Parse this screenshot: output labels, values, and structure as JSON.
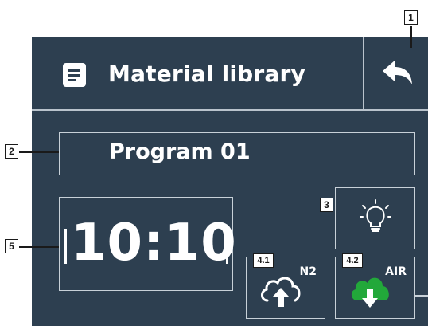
{
  "header": {
    "title": "Material library",
    "title_icon": "document-icon",
    "back_icon": "back-arrow-icon"
  },
  "program": {
    "label": "Program 01"
  },
  "clock": {
    "time": "10:10"
  },
  "light": {
    "icon": "lightbulb-icon"
  },
  "gas_buttons": [
    {
      "label": "N2",
      "icon": "cloud-upload-icon",
      "color": "#ffffff"
    },
    {
      "label": "AIR",
      "icon": "cloud-download-icon",
      "color": "#22a83a"
    }
  ],
  "callouts": [
    "1",
    "2",
    "3",
    "4.1",
    "4.2",
    "5"
  ],
  "colors": {
    "panel": "#2d3f50",
    "border": "#c8d1d8",
    "accent_green": "#22a83a"
  }
}
